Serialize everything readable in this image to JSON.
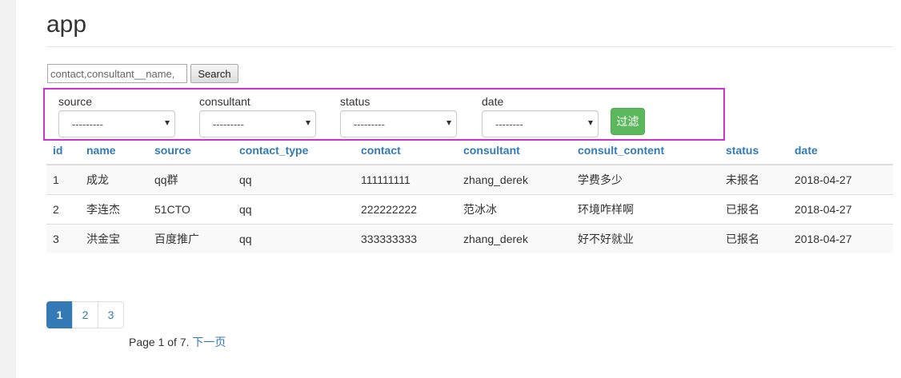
{
  "app_title": "app",
  "search": {
    "placeholder": "contact,consultant__name,",
    "button_label": "Search"
  },
  "filters": [
    {
      "label": "source",
      "selected": "---------"
    },
    {
      "label": "consultant",
      "selected": "---------"
    },
    {
      "label": "status",
      "selected": "---------"
    },
    {
      "label": "date",
      "selected": "--------"
    }
  ],
  "filter_button_label": "过滤",
  "table": {
    "headers": [
      "id",
      "name",
      "source",
      "contact_type",
      "contact",
      "consultant",
      "consult_content",
      "status",
      "date"
    ],
    "rows": [
      [
        "1",
        "成龙",
        "qq群",
        "qq",
        "111111111",
        "zhang_derek",
        "学费多少",
        "未报名",
        "2018-04-27"
      ],
      [
        "2",
        "李连杰",
        "51CTO",
        "qq",
        "222222222",
        "范冰冰",
        "环境咋样啊",
        "已报名",
        "2018-04-27"
      ],
      [
        "3",
        "洪金宝",
        "百度推广",
        "qq",
        "333333333",
        "zhang_derek",
        "好不好就业",
        "已报名",
        "2018-04-27"
      ]
    ]
  },
  "pagination": {
    "pages": [
      "1",
      "2",
      "3"
    ],
    "active": "1",
    "info_text": "Page 1 of 7.",
    "next_label": "下一页"
  },
  "colors": {
    "link": "#337ab7",
    "success": "#5cb85c",
    "highlight_border": "#cc33cc"
  }
}
